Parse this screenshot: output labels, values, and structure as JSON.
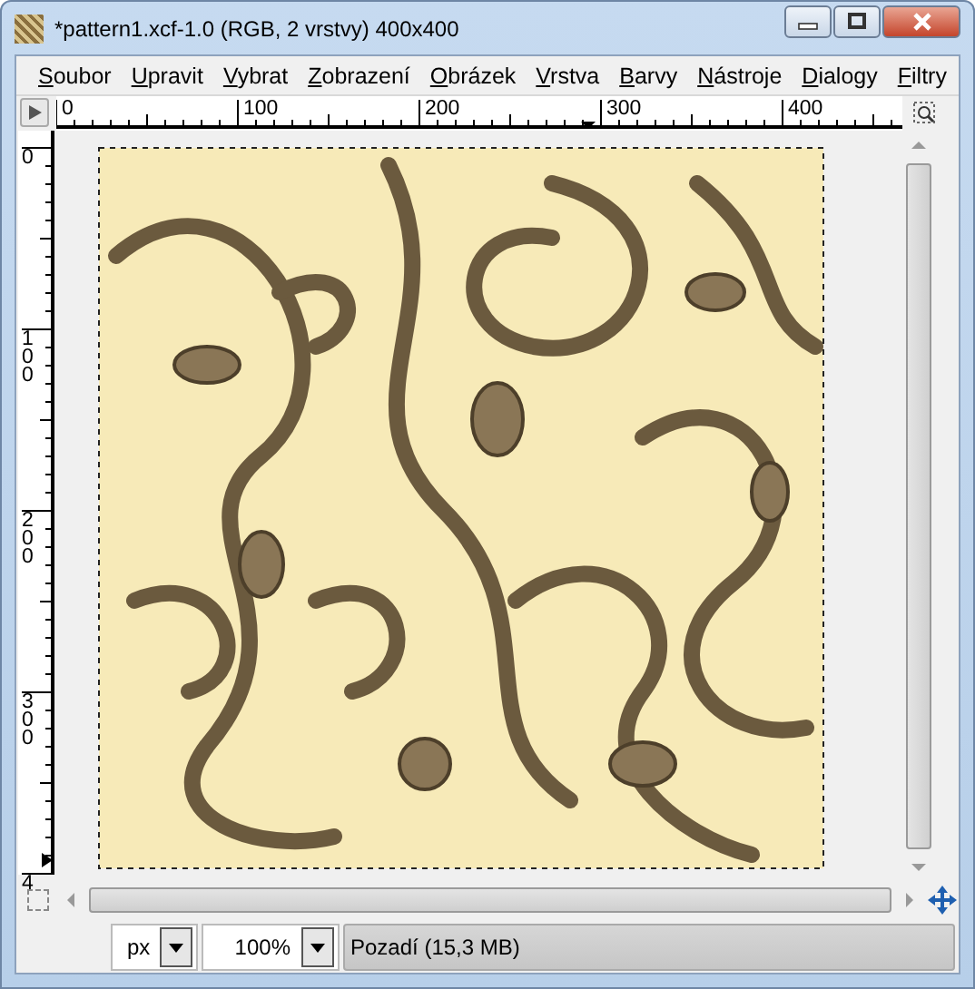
{
  "window": {
    "title": "*pattern1.xcf-1.0 (RGB, 2 vrstvy) 400x400"
  },
  "menu": [
    "Soubor",
    "Upravit",
    "Vybrat",
    "Zobrazení",
    "Obrázek",
    "Vrstva",
    "Barvy",
    "Nástroje",
    "Dialogy",
    "Filtry"
  ],
  "ruler_horizontal": {
    "labels": [
      "0",
      "100",
      "200",
      "300",
      "400"
    ]
  },
  "ruler_vertical": {
    "labels": [
      "0",
      "100",
      "200",
      "300",
      "4"
    ]
  },
  "status_bar": {
    "unit": "px",
    "zoom": "100%",
    "layer_info": "Pozadí (15,3 MB)"
  }
}
